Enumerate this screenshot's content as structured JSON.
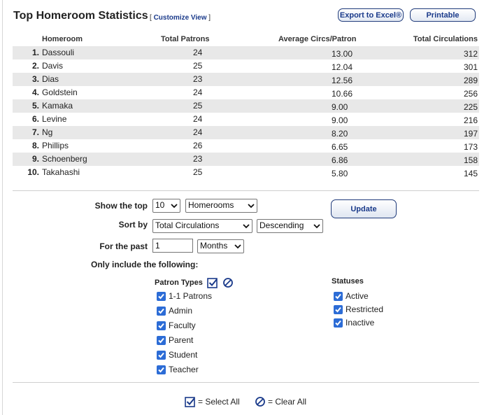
{
  "header": {
    "title": "Top Homeroom Statistics",
    "customize_prefix": "[",
    "customize_label": "Customize View",
    "customize_suffix": "]",
    "export_label": "Export to Excel®",
    "printable_label": "Printable"
  },
  "table": {
    "columns": [
      "Homeroom",
      "Total Patrons",
      "Average Circs/Patron",
      "Total Circulations"
    ],
    "rows": [
      {
        "rank": "1.",
        "name": "Dassouli",
        "patrons": "24",
        "avg": "13.00",
        "total": "312"
      },
      {
        "rank": "2.",
        "name": "Davis",
        "patrons": "25",
        "avg": "12.04",
        "total": "301"
      },
      {
        "rank": "3.",
        "name": "Dias",
        "patrons": "23",
        "avg": "12.56",
        "total": "289"
      },
      {
        "rank": "4.",
        "name": "Goldstein",
        "patrons": "24",
        "avg": "10.66",
        "total": "256"
      },
      {
        "rank": "5.",
        "name": "Kamaka",
        "patrons": "25",
        "avg": "9.00",
        "total": "225"
      },
      {
        "rank": "6.",
        "name": "Levine",
        "patrons": "24",
        "avg": "9.00",
        "total": "216"
      },
      {
        "rank": "7.",
        "name": "Ng",
        "patrons": "24",
        "avg": "8.20",
        "total": "197"
      },
      {
        "rank": "8.",
        "name": "Phillips",
        "patrons": "26",
        "avg": "6.65",
        "total": "173"
      },
      {
        "rank": "9.",
        "name": "Schoenberg",
        "patrons": "23",
        "avg": "6.86",
        "total": "158"
      },
      {
        "rank": "10.",
        "name": "Takahashi",
        "patrons": "25",
        "avg": "5.80",
        "total": "145"
      }
    ]
  },
  "options": {
    "show_top_label": "Show the top",
    "show_top_value": "10",
    "show_top_kind": "Homerooms",
    "sort_by_label": "Sort by",
    "sort_field": "Total Circulations",
    "sort_order": "Descending",
    "for_past_label": "For the past",
    "for_past_value": "1",
    "for_past_unit": "Months",
    "update_label": "Update",
    "only_include_label": "Only include the following:"
  },
  "patron_types": {
    "label": "Patron Types",
    "items": [
      {
        "label": "1-1 Patrons",
        "checked": true
      },
      {
        "label": "Admin",
        "checked": true
      },
      {
        "label": "Faculty",
        "checked": true
      },
      {
        "label": "Parent",
        "checked": true
      },
      {
        "label": "Student",
        "checked": true
      },
      {
        "label": "Teacher",
        "checked": true
      }
    ]
  },
  "statuses": {
    "label": "Statuses",
    "items": [
      {
        "label": "Active",
        "checked": true
      },
      {
        "label": "Restricted",
        "checked": true
      },
      {
        "label": "Inactive",
        "checked": true
      }
    ]
  },
  "footer": {
    "select_all_label": "= Select All",
    "clear_all_label": "= Clear All"
  },
  "colors": {
    "accent": "#1a3a8a",
    "checkbox": "#2c6cd6",
    "row_shade": "#e8e8e8"
  }
}
